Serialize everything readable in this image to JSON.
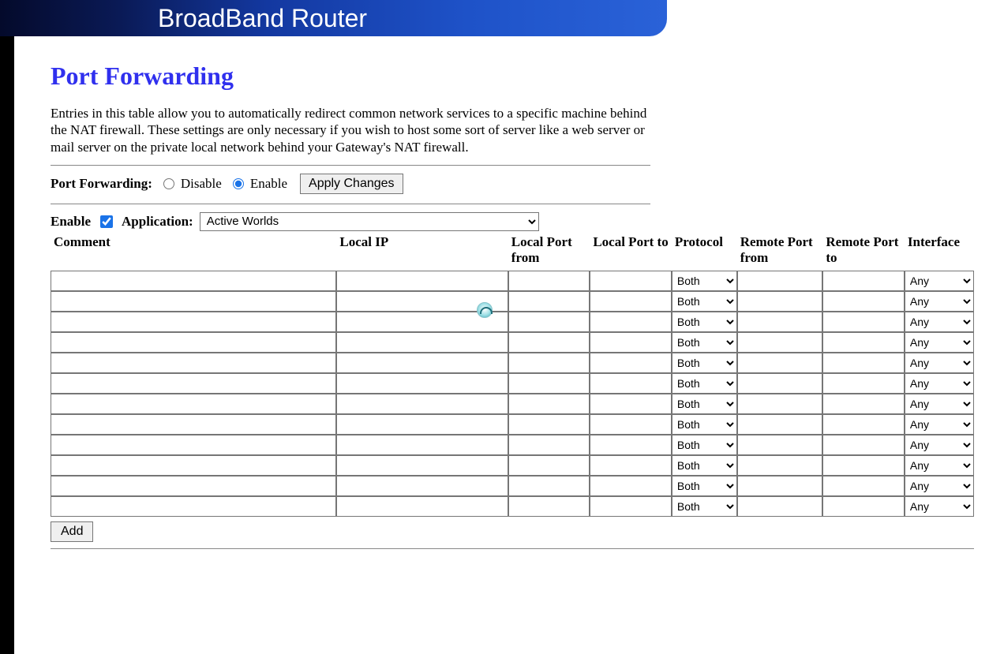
{
  "banner": {
    "title": "BroadBand Router"
  },
  "page": {
    "title": "Port Forwarding",
    "description": "Entries in this table allow you to automatically redirect common network services to a specific machine behind the NAT firewall. These settings are only necessary if you wish to host some sort of server like a web server or mail server on the private local network behind your Gateway's NAT firewall."
  },
  "pf_toggle": {
    "label": "Port Forwarding:",
    "disable_label": "Disable",
    "enable_label": "Enable",
    "selected": "enable",
    "apply_label": "Apply Changes"
  },
  "entry": {
    "enable_label": "Enable",
    "enable_checked": true,
    "application_label": "Application:",
    "application_selected": "Active Worlds"
  },
  "table": {
    "headers": {
      "comment": "Comment",
      "local_ip": "Local IP",
      "local_port_from": "Local Port from",
      "local_port_to": "Local Port to",
      "protocol": "Protocol",
      "remote_port_from": "Remote Port from",
      "remote_port_to": "Remote Port to",
      "interface": "Interface"
    },
    "rows": [
      {
        "comment": "",
        "local_ip": "",
        "lp_from": "",
        "lp_to": "",
        "protocol": "Both",
        "rp_from": "",
        "rp_to": "",
        "interface": "Any"
      },
      {
        "comment": "",
        "local_ip": "",
        "lp_from": "",
        "lp_to": "",
        "protocol": "Both",
        "rp_from": "",
        "rp_to": "",
        "interface": "Any"
      },
      {
        "comment": "",
        "local_ip": "",
        "lp_from": "",
        "lp_to": "",
        "protocol": "Both",
        "rp_from": "",
        "rp_to": "",
        "interface": "Any"
      },
      {
        "comment": "",
        "local_ip": "",
        "lp_from": "",
        "lp_to": "",
        "protocol": "Both",
        "rp_from": "",
        "rp_to": "",
        "interface": "Any"
      },
      {
        "comment": "",
        "local_ip": "",
        "lp_from": "",
        "lp_to": "",
        "protocol": "Both",
        "rp_from": "",
        "rp_to": "",
        "interface": "Any"
      },
      {
        "comment": "",
        "local_ip": "",
        "lp_from": "",
        "lp_to": "",
        "protocol": "Both",
        "rp_from": "",
        "rp_to": "",
        "interface": "Any"
      },
      {
        "comment": "",
        "local_ip": "",
        "lp_from": "",
        "lp_to": "",
        "protocol": "Both",
        "rp_from": "",
        "rp_to": "",
        "interface": "Any"
      },
      {
        "comment": "",
        "local_ip": "",
        "lp_from": "",
        "lp_to": "",
        "protocol": "Both",
        "rp_from": "",
        "rp_to": "",
        "interface": "Any"
      },
      {
        "comment": "",
        "local_ip": "",
        "lp_from": "",
        "lp_to": "",
        "protocol": "Both",
        "rp_from": "",
        "rp_to": "",
        "interface": "Any"
      },
      {
        "comment": "",
        "local_ip": "",
        "lp_from": "",
        "lp_to": "",
        "protocol": "Both",
        "rp_from": "",
        "rp_to": "",
        "interface": "Any"
      },
      {
        "comment": "",
        "local_ip": "",
        "lp_from": "",
        "lp_to": "",
        "protocol": "Both",
        "rp_from": "",
        "rp_to": "",
        "interface": "Any"
      },
      {
        "comment": "",
        "local_ip": "",
        "lp_from": "",
        "lp_to": "",
        "protocol": "Both",
        "rp_from": "",
        "rp_to": "",
        "interface": "Any"
      }
    ]
  },
  "buttons": {
    "add": "Add"
  }
}
